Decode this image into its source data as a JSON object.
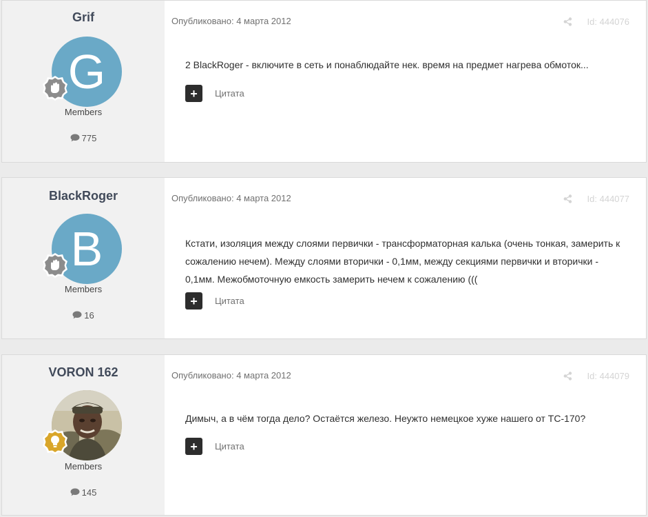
{
  "posts": [
    {
      "author": "Grif",
      "avatar_letter": "G",
      "avatar_color": "#6aa9c7",
      "group": "Members",
      "post_count": "775",
      "published": "Опубликовано: 4 марта 2012",
      "post_id": "Id: 444076",
      "body": "2 BlackRoger - включите в сеть и понаблюдайте нек. время на предмет нагрева обмоток...",
      "quote_label": "Цитата",
      "rank_icon": "hand-badge-icon"
    },
    {
      "author": "BlackRoger",
      "avatar_letter": "B",
      "avatar_color": "#6aa9c7",
      "group": "Members",
      "post_count": "16",
      "published": "Опубликовано: 4 марта 2012",
      "post_id": "Id: 444077",
      "body": "Кстати, изоляция между слоями первички - трансформаторная калька (очень тонкая, замерить к сожалению нечем). Между слоями вторички - 0,1мм, между секциями первички и вторички - 0,1мм. Межобмоточную емкость замерить нечем к сожалению (((",
      "quote_label": "Цитата",
      "rank_icon": "hand-badge-icon"
    },
    {
      "author": "VORON 162",
      "avatar_letter": "",
      "avatar_color": "#b8ad8c",
      "group": "Members",
      "post_count": "145",
      "published": "Опубликовано: 4 марта 2012",
      "post_id": "Id: 444079",
      "body": "Димыч, а в чём тогда дело? Остаётся железо. Неужто немецкое хуже нашего от ТС-170?",
      "quote_label": "Цитата",
      "rank_icon": "lightbulb-badge-icon"
    }
  ]
}
